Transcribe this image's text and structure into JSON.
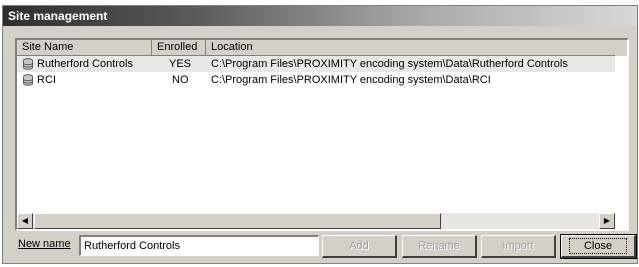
{
  "window": {
    "title": "Site management"
  },
  "list": {
    "columns": [
      "Site Name",
      "Enrolled",
      "Location"
    ],
    "rows": [
      {
        "name": "Rutherford Controls",
        "enrolled": "YES",
        "location": "C:\\Program Files\\PROXIMITY encoding system\\Data\\Rutherford Controls",
        "selected": true
      },
      {
        "name": "RCI",
        "enrolled": "NO",
        "location": "C:\\Program Files\\PROXIMITY encoding system\\Data\\RCI",
        "selected": false
      }
    ],
    "row_icon": "database-icon"
  },
  "form": {
    "new_name_label": "New name",
    "new_name_value": "Rutherford Controls"
  },
  "buttons": {
    "add": "Add",
    "rename": "Rename",
    "import": "Import",
    "close": "Close"
  }
}
